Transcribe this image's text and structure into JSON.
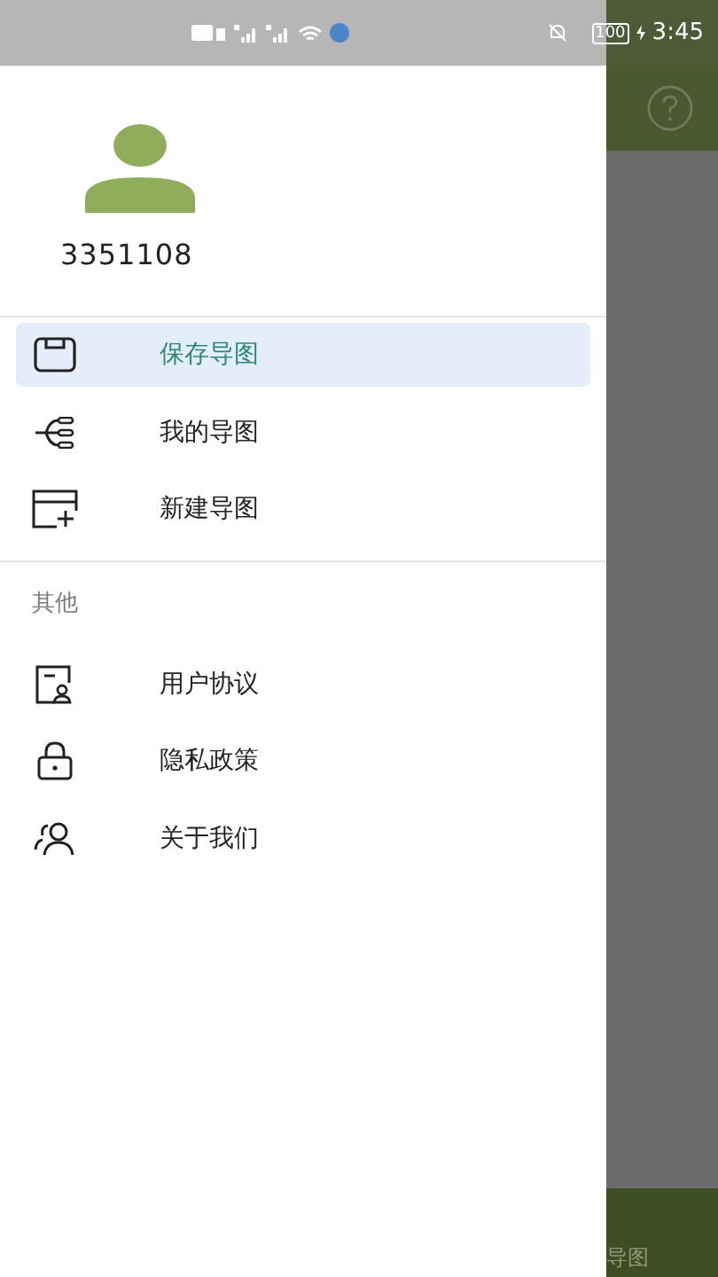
{
  "status_bar": {
    "battery": "100",
    "time": "3:45"
  },
  "drawer": {
    "user_id": "3351108",
    "items": [
      {
        "label": "保存导图",
        "kind": "save",
        "selected": true
      },
      {
        "label": "我的导图",
        "kind": "tree",
        "selected": false
      },
      {
        "label": "新建导图",
        "kind": "new",
        "selected": false
      }
    ],
    "section_title": "其他",
    "other_items": [
      {
        "label": "用户协议",
        "kind": "doc",
        "selected": false
      },
      {
        "label": "隐私政策",
        "kind": "lock",
        "selected": false
      },
      {
        "label": "关于我们",
        "kind": "people",
        "selected": false
      }
    ]
  },
  "background": {
    "bottom_nav_label": "导图"
  }
}
